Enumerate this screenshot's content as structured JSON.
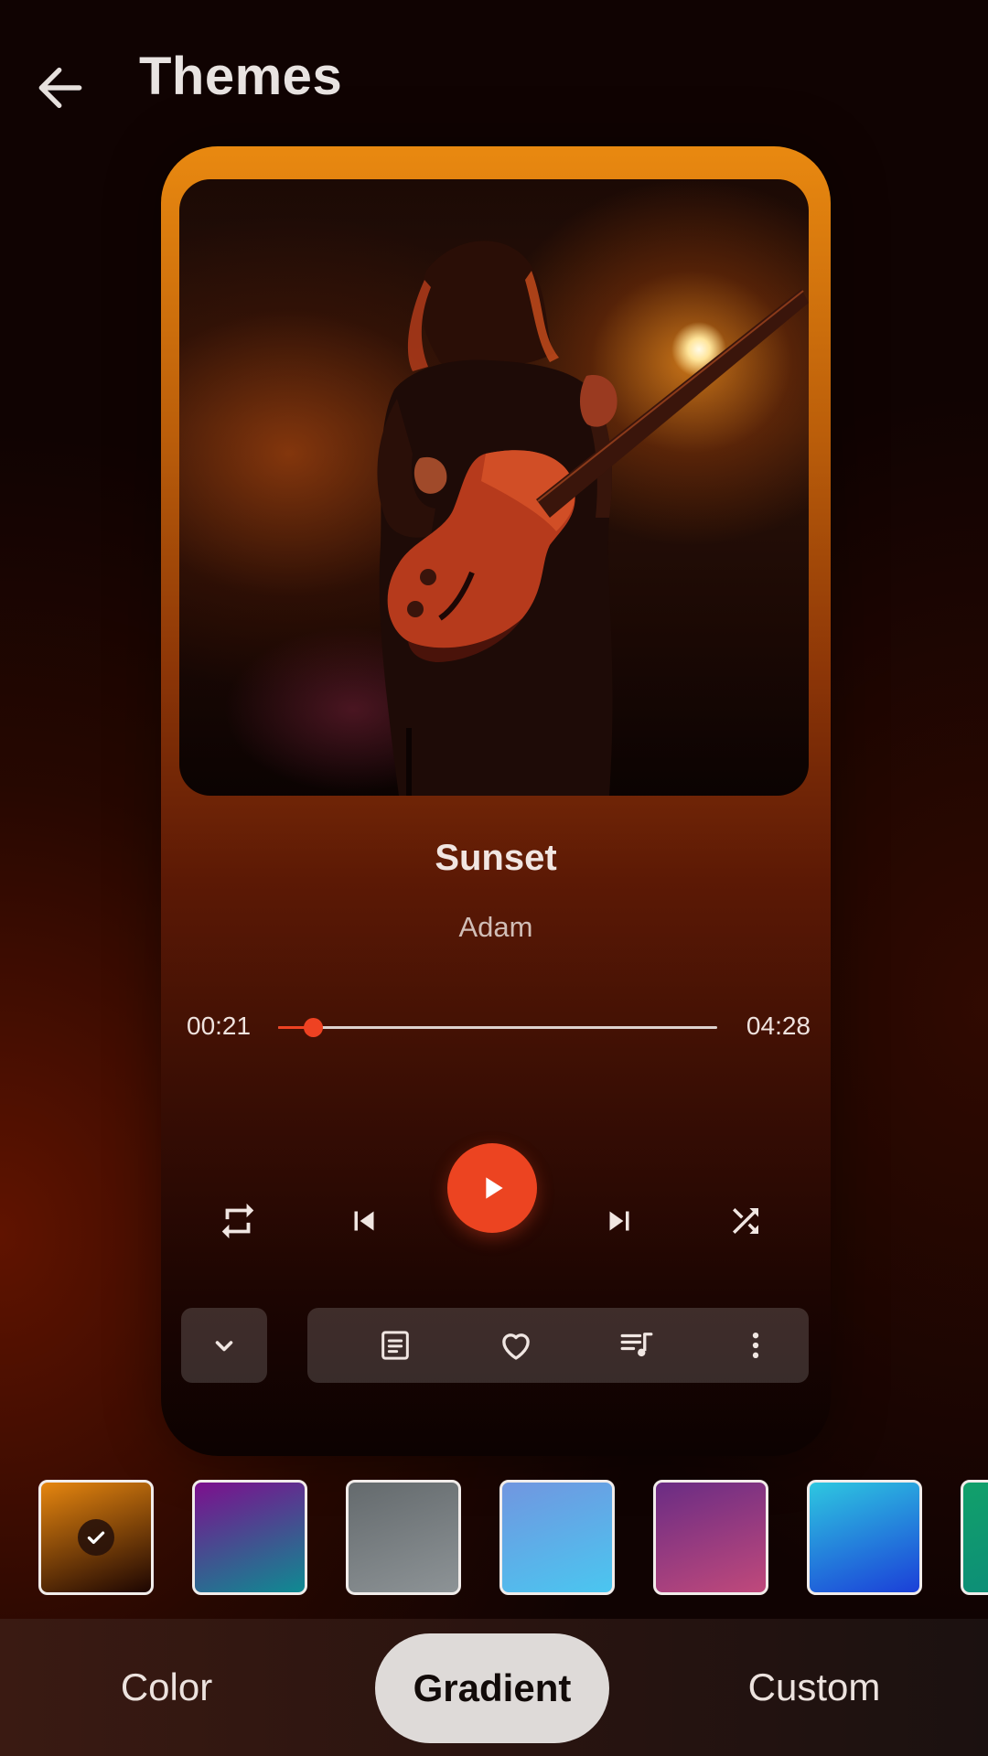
{
  "header": {
    "title": "Themes",
    "back_icon": "arrow-left-icon"
  },
  "player": {
    "song_title": "Sunset",
    "artist": "Adam",
    "current_time": "00:21",
    "total_time": "04:28",
    "progress_fraction": 0.08,
    "accent_color": "#ec4421",
    "controls": [
      "repeat-icon",
      "skip-previous-icon",
      "play-icon",
      "skip-next-icon",
      "shuffle-icon"
    ],
    "actions": [
      "lyrics-icon",
      "heart-icon",
      "playlist-icon",
      "more-vertical-icon"
    ],
    "collapse_icon": "chevron-down-icon"
  },
  "swatches": [
    {
      "name": "orange-dark",
      "from": "#e6860f",
      "to": "#1c0502",
      "selected": true
    },
    {
      "name": "purple-teal",
      "from": "#7d0f8e",
      "to": "#0e8b92",
      "selected": false
    },
    {
      "name": "gray",
      "from": "#646a6d",
      "to": "#8d9396",
      "selected": false
    },
    {
      "name": "sky-blue",
      "from": "#7196e0",
      "to": "#4ac6f0",
      "selected": false
    },
    {
      "name": "purple-pink",
      "from": "#6a2c84",
      "to": "#c0497b",
      "selected": false
    },
    {
      "name": "cyan-blue",
      "from": "#2ec7e0",
      "to": "#1b3fd8",
      "selected": false
    },
    {
      "name": "green-teal",
      "from": "#12a06a",
      "to": "#0b8a7a",
      "selected": false
    }
  ],
  "tabs": {
    "color": "Color",
    "gradient": "Gradient",
    "custom": "Custom",
    "selected": "Gradient"
  }
}
